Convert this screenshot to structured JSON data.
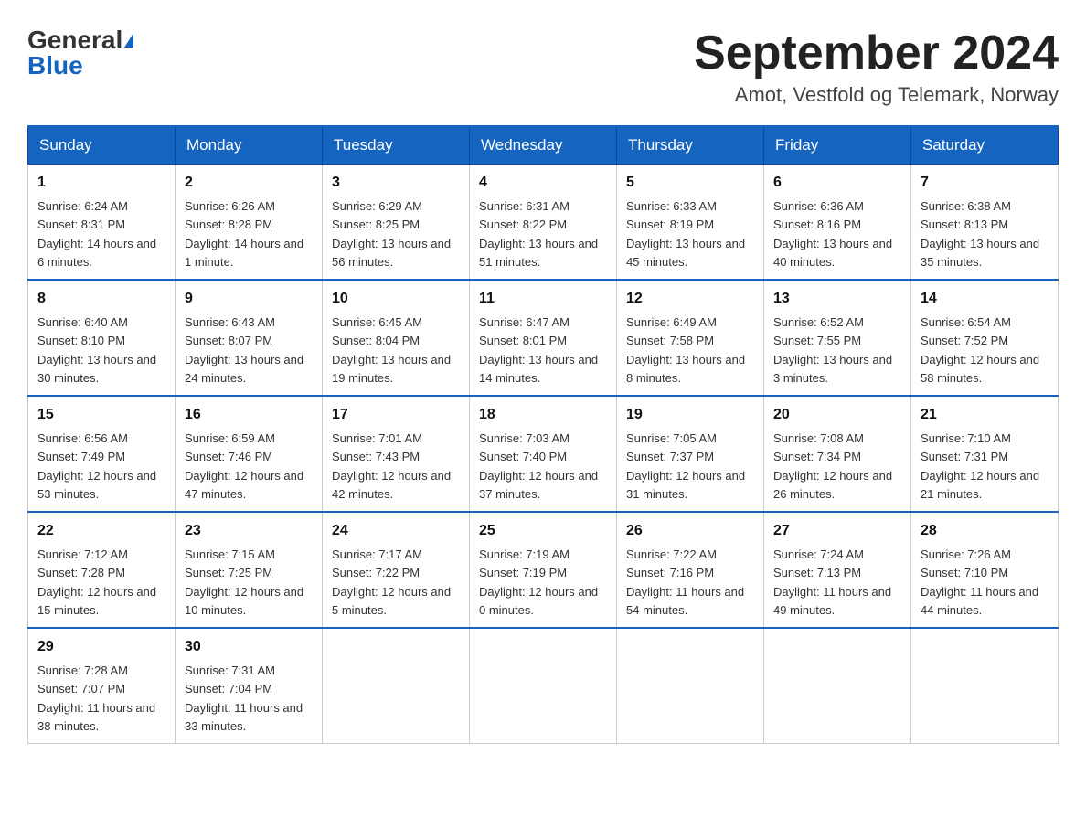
{
  "header": {
    "logo_general": "General",
    "logo_blue": "Blue",
    "month_title": "September 2024",
    "location": "Amot, Vestfold og Telemark, Norway"
  },
  "days_of_week": [
    "Sunday",
    "Monday",
    "Tuesday",
    "Wednesday",
    "Thursday",
    "Friday",
    "Saturday"
  ],
  "weeks": [
    [
      {
        "day": "1",
        "sunrise": "Sunrise: 6:24 AM",
        "sunset": "Sunset: 8:31 PM",
        "daylight": "Daylight: 14 hours and 6 minutes."
      },
      {
        "day": "2",
        "sunrise": "Sunrise: 6:26 AM",
        "sunset": "Sunset: 8:28 PM",
        "daylight": "Daylight: 14 hours and 1 minute."
      },
      {
        "day": "3",
        "sunrise": "Sunrise: 6:29 AM",
        "sunset": "Sunset: 8:25 PM",
        "daylight": "Daylight: 13 hours and 56 minutes."
      },
      {
        "day": "4",
        "sunrise": "Sunrise: 6:31 AM",
        "sunset": "Sunset: 8:22 PM",
        "daylight": "Daylight: 13 hours and 51 minutes."
      },
      {
        "day": "5",
        "sunrise": "Sunrise: 6:33 AM",
        "sunset": "Sunset: 8:19 PM",
        "daylight": "Daylight: 13 hours and 45 minutes."
      },
      {
        "day": "6",
        "sunrise": "Sunrise: 6:36 AM",
        "sunset": "Sunset: 8:16 PM",
        "daylight": "Daylight: 13 hours and 40 minutes."
      },
      {
        "day": "7",
        "sunrise": "Sunrise: 6:38 AM",
        "sunset": "Sunset: 8:13 PM",
        "daylight": "Daylight: 13 hours and 35 minutes."
      }
    ],
    [
      {
        "day": "8",
        "sunrise": "Sunrise: 6:40 AM",
        "sunset": "Sunset: 8:10 PM",
        "daylight": "Daylight: 13 hours and 30 minutes."
      },
      {
        "day": "9",
        "sunrise": "Sunrise: 6:43 AM",
        "sunset": "Sunset: 8:07 PM",
        "daylight": "Daylight: 13 hours and 24 minutes."
      },
      {
        "day": "10",
        "sunrise": "Sunrise: 6:45 AM",
        "sunset": "Sunset: 8:04 PM",
        "daylight": "Daylight: 13 hours and 19 minutes."
      },
      {
        "day": "11",
        "sunrise": "Sunrise: 6:47 AM",
        "sunset": "Sunset: 8:01 PM",
        "daylight": "Daylight: 13 hours and 14 minutes."
      },
      {
        "day": "12",
        "sunrise": "Sunrise: 6:49 AM",
        "sunset": "Sunset: 7:58 PM",
        "daylight": "Daylight: 13 hours and 8 minutes."
      },
      {
        "day": "13",
        "sunrise": "Sunrise: 6:52 AM",
        "sunset": "Sunset: 7:55 PM",
        "daylight": "Daylight: 13 hours and 3 minutes."
      },
      {
        "day": "14",
        "sunrise": "Sunrise: 6:54 AM",
        "sunset": "Sunset: 7:52 PM",
        "daylight": "Daylight: 12 hours and 58 minutes."
      }
    ],
    [
      {
        "day": "15",
        "sunrise": "Sunrise: 6:56 AM",
        "sunset": "Sunset: 7:49 PM",
        "daylight": "Daylight: 12 hours and 53 minutes."
      },
      {
        "day": "16",
        "sunrise": "Sunrise: 6:59 AM",
        "sunset": "Sunset: 7:46 PM",
        "daylight": "Daylight: 12 hours and 47 minutes."
      },
      {
        "day": "17",
        "sunrise": "Sunrise: 7:01 AM",
        "sunset": "Sunset: 7:43 PM",
        "daylight": "Daylight: 12 hours and 42 minutes."
      },
      {
        "day": "18",
        "sunrise": "Sunrise: 7:03 AM",
        "sunset": "Sunset: 7:40 PM",
        "daylight": "Daylight: 12 hours and 37 minutes."
      },
      {
        "day": "19",
        "sunrise": "Sunrise: 7:05 AM",
        "sunset": "Sunset: 7:37 PM",
        "daylight": "Daylight: 12 hours and 31 minutes."
      },
      {
        "day": "20",
        "sunrise": "Sunrise: 7:08 AM",
        "sunset": "Sunset: 7:34 PM",
        "daylight": "Daylight: 12 hours and 26 minutes."
      },
      {
        "day": "21",
        "sunrise": "Sunrise: 7:10 AM",
        "sunset": "Sunset: 7:31 PM",
        "daylight": "Daylight: 12 hours and 21 minutes."
      }
    ],
    [
      {
        "day": "22",
        "sunrise": "Sunrise: 7:12 AM",
        "sunset": "Sunset: 7:28 PM",
        "daylight": "Daylight: 12 hours and 15 minutes."
      },
      {
        "day": "23",
        "sunrise": "Sunrise: 7:15 AM",
        "sunset": "Sunset: 7:25 PM",
        "daylight": "Daylight: 12 hours and 10 minutes."
      },
      {
        "day": "24",
        "sunrise": "Sunrise: 7:17 AM",
        "sunset": "Sunset: 7:22 PM",
        "daylight": "Daylight: 12 hours and 5 minutes."
      },
      {
        "day": "25",
        "sunrise": "Sunrise: 7:19 AM",
        "sunset": "Sunset: 7:19 PM",
        "daylight": "Daylight: 12 hours and 0 minutes."
      },
      {
        "day": "26",
        "sunrise": "Sunrise: 7:22 AM",
        "sunset": "Sunset: 7:16 PM",
        "daylight": "Daylight: 11 hours and 54 minutes."
      },
      {
        "day": "27",
        "sunrise": "Sunrise: 7:24 AM",
        "sunset": "Sunset: 7:13 PM",
        "daylight": "Daylight: 11 hours and 49 minutes."
      },
      {
        "day": "28",
        "sunrise": "Sunrise: 7:26 AM",
        "sunset": "Sunset: 7:10 PM",
        "daylight": "Daylight: 11 hours and 44 minutes."
      }
    ],
    [
      {
        "day": "29",
        "sunrise": "Sunrise: 7:28 AM",
        "sunset": "Sunset: 7:07 PM",
        "daylight": "Daylight: 11 hours and 38 minutes."
      },
      {
        "day": "30",
        "sunrise": "Sunrise: 7:31 AM",
        "sunset": "Sunset: 7:04 PM",
        "daylight": "Daylight: 11 hours and 33 minutes."
      },
      null,
      null,
      null,
      null,
      null
    ]
  ]
}
